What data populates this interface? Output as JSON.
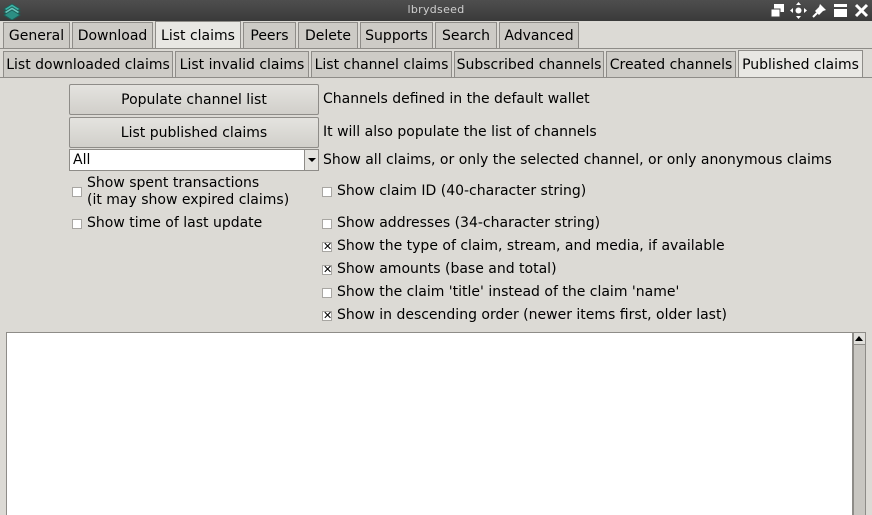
{
  "window": {
    "title": "lbrydseed",
    "controls": [
      "restore-icon",
      "move-icon",
      "pin-icon",
      "shade-icon",
      "close-icon"
    ]
  },
  "main_tabs": [
    {
      "label": "General"
    },
    {
      "label": "Download"
    },
    {
      "label": "List claims",
      "active": true
    },
    {
      "label": "Peers"
    },
    {
      "label": "Delete"
    },
    {
      "label": "Supports"
    },
    {
      "label": "Search"
    },
    {
      "label": "Advanced"
    }
  ],
  "sub_tabs": [
    {
      "label": "List downloaded claims"
    },
    {
      "label": "List invalid claims"
    },
    {
      "label": "List channel claims"
    },
    {
      "label": "Subscribed channels"
    },
    {
      "label": "Created channels"
    },
    {
      "label": "Published claims",
      "active": true
    }
  ],
  "actions": {
    "populate_button": "Populate channel list",
    "populate_desc": "Channels defined in the default wallet",
    "list_button": "List published claims",
    "list_desc": "It will also populate the list of channels",
    "filter_value": "All",
    "filter_desc": "Show all claims, or only the selected channel, or only anonymous claims"
  },
  "left_options": [
    {
      "label": "Show spent transactions",
      "label2": "(it may show expired claims)",
      "checked": false
    },
    {
      "label": "Show time of last update",
      "checked": false
    }
  ],
  "right_options": [
    {
      "label": "Show claim ID (40-character string)",
      "checked": false
    },
    {
      "label": "Show addresses (34-character string)",
      "checked": false
    },
    {
      "label": "Show the type of claim, stream, and media, if available",
      "checked": true
    },
    {
      "label": "Show amounts (base and total)",
      "checked": true
    },
    {
      "label": "Show the claim 'title' instead of the claim 'name'",
      "checked": false
    },
    {
      "label": "Show in descending order (newer items first, older last)",
      "checked": true
    }
  ],
  "output": {
    "text": ""
  }
}
